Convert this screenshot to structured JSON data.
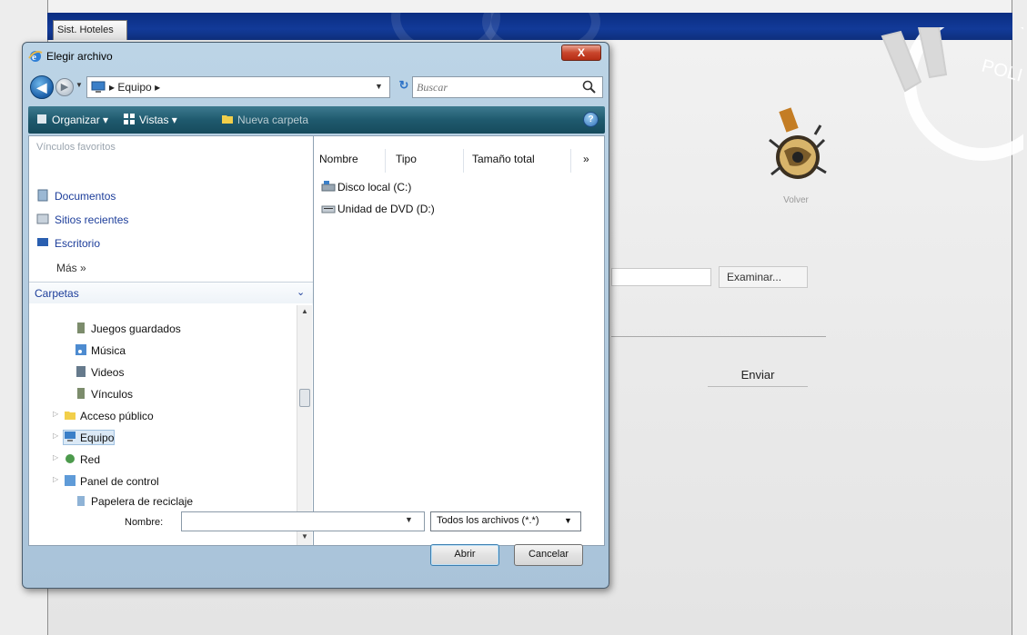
{
  "page": {
    "tab_label": "Sist. Hoteles",
    "volver_label": "Volver",
    "examinar_label": "Examinar...",
    "enviar_label": "Enviar",
    "badge_text": "POLI"
  },
  "dialog": {
    "title": "Elegir archivo",
    "close_label": "X",
    "address": {
      "crumb": "Equipo",
      "search_placeholder": "Buscar"
    },
    "toolbar": {
      "organize": "Organizar",
      "views": "Vistas",
      "new_folder": "Nueva carpeta",
      "help": "?"
    },
    "favorites": {
      "header": "Vínculos favoritos",
      "items": [
        "Documentos",
        "Sitios recientes",
        "Escritorio"
      ],
      "more": "Más »"
    },
    "folders": {
      "header": "Carpetas",
      "items": [
        "Juegos guardados",
        "Música",
        "Videos",
        "Vínculos",
        "Acceso público",
        "Equipo",
        "Red",
        "Panel de control",
        "Papelera de reciclaje"
      ],
      "selected": "Equipo"
    },
    "columns": [
      "Nombre",
      "Tipo",
      "Tamaño total",
      "»"
    ],
    "files": [
      "Disco local (C:)",
      "Unidad de DVD (D:)"
    ],
    "name_label": "Nombre:",
    "name_value": "",
    "file_type": "Todos los archivos (*.*)",
    "open_button": "Abrir",
    "cancel_button": "Cancelar"
  },
  "colors": {
    "banner": "#0e2f7c",
    "toolbar": "#1f5a6e",
    "link": "#1c3d9a",
    "close": "#c9462c"
  }
}
